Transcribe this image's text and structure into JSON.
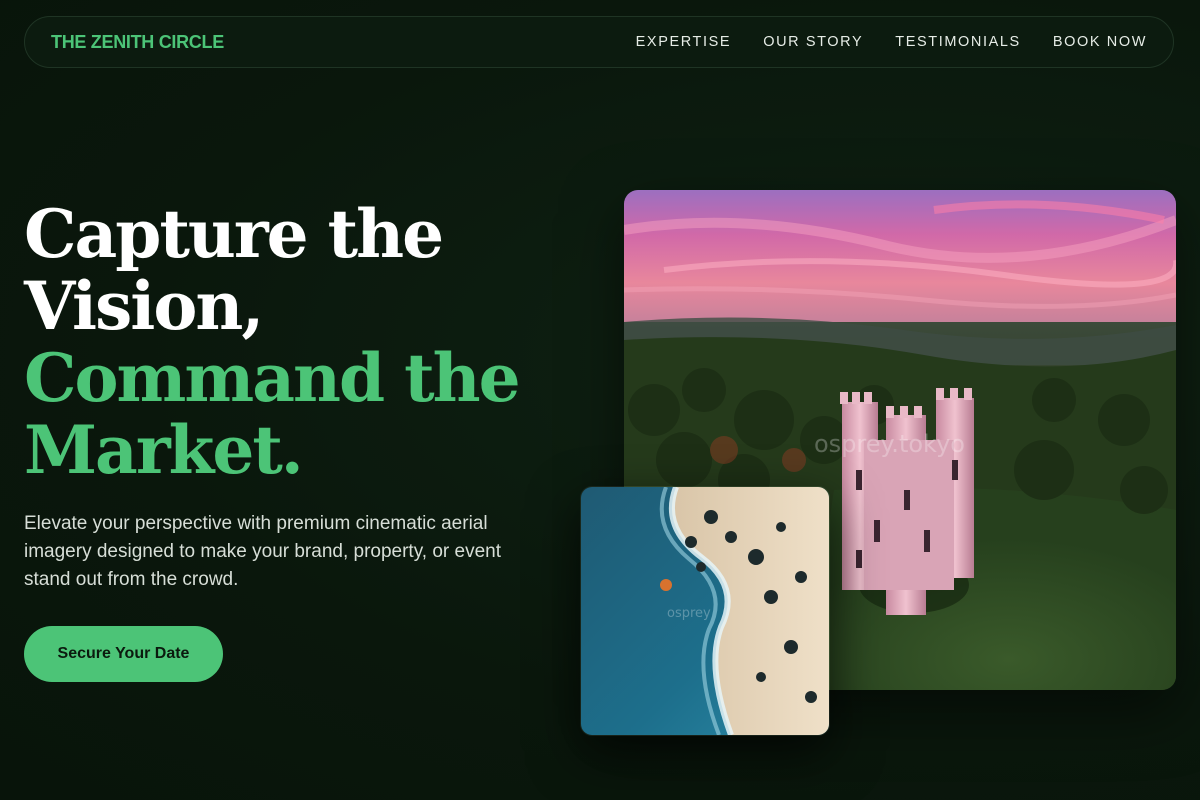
{
  "nav": {
    "brand": "THE ZENITH CIRCLE",
    "links": [
      "EXPERTISE",
      "OUR STORY",
      "TESTIMONIALS",
      "BOOK NOW"
    ]
  },
  "hero": {
    "title_lines_white": [
      "Capture the",
      "Vision,"
    ],
    "title_lines_green": [
      "Command the",
      "Market."
    ],
    "description": "Elevate your perspective with premium cinematic aerial imagery designed to make your brand, property, or event stand out from the crowd.",
    "cta_label": "Secure Your Date"
  },
  "images": {
    "castle_watermark": "osprey.tokyo",
    "coast_watermark": "osprey"
  },
  "colors": {
    "background": "#0a180d",
    "accent": "#4cc477",
    "text": "#ffffff"
  }
}
